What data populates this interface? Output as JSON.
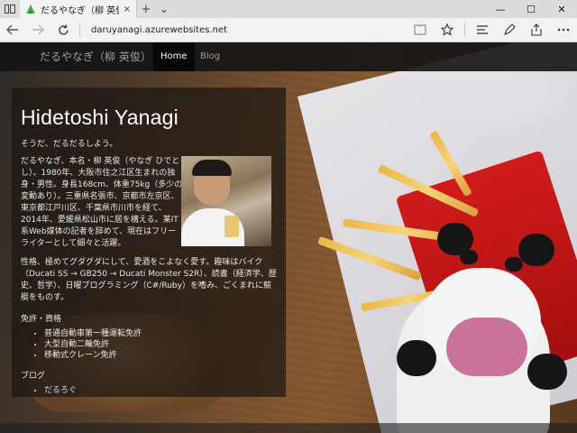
{
  "browser": {
    "tab_title": "だるやなぎ（柳 英俊） - ",
    "tab_close": "×",
    "new_tab": "+",
    "tab_menu": "⌄",
    "url": "daruyanagi.azurewebsites.net",
    "window_controls": {
      "minimize": "—",
      "maximize": "☐",
      "close": "✕"
    },
    "icons": [
      "tab-preview-icon",
      "back-icon",
      "forward-icon",
      "refresh-icon",
      "reading-view-icon",
      "favorite-star-icon",
      "hub-icon",
      "web-note-icon",
      "share-icon",
      "more-icon"
    ]
  },
  "site": {
    "brand": "だるやなぎ（柳 英俊）",
    "nav": [
      {
        "label": "Home",
        "active": true
      },
      {
        "label": "Blog",
        "active": false
      }
    ]
  },
  "profile": {
    "name": "Hidetoshi Yanagi",
    "tagline": "そうだ、だるだるしよう。",
    "bio": "だるやなぎ、本名・柳 英俊（やなぎ ひでとし）。1980年、大阪市住之江区生まれの独身・男性。身長168cm、体重75kg（多少の変動あり）。三重県名張市、京都市左京区、東京都江戸川区、千葉県市川市を経て、2014年、愛媛県松山市に居を構える。某IT系Web媒体の記者を辞めて、現在はフリーライターとして細々と活躍。",
    "bio2": "性格、極めてグダグダにして、愛酒をこよなく愛す。趣味はバイク（Ducati SS → GB250 → Ducati Monster S2R）、読書（経済学、歴史、哲学）、日曜プログラミング（C#/Ruby）を嗜み、ごくまれに競艇をものす。",
    "licenses_title": "免許・資格",
    "licenses": [
      "普通自動車第一種運転免許",
      "大型自動二輪免許",
      "移動式クレーン免許"
    ],
    "blog_title": "ブログ",
    "blog_links": [
      "だるろぐ"
    ]
  },
  "colors": {
    "navbar_bg": "#141414",
    "nav_active_bg": "#080808",
    "panel_bg": "rgba(28,22,18,0.72)",
    "link": "#cfd8ff"
  }
}
